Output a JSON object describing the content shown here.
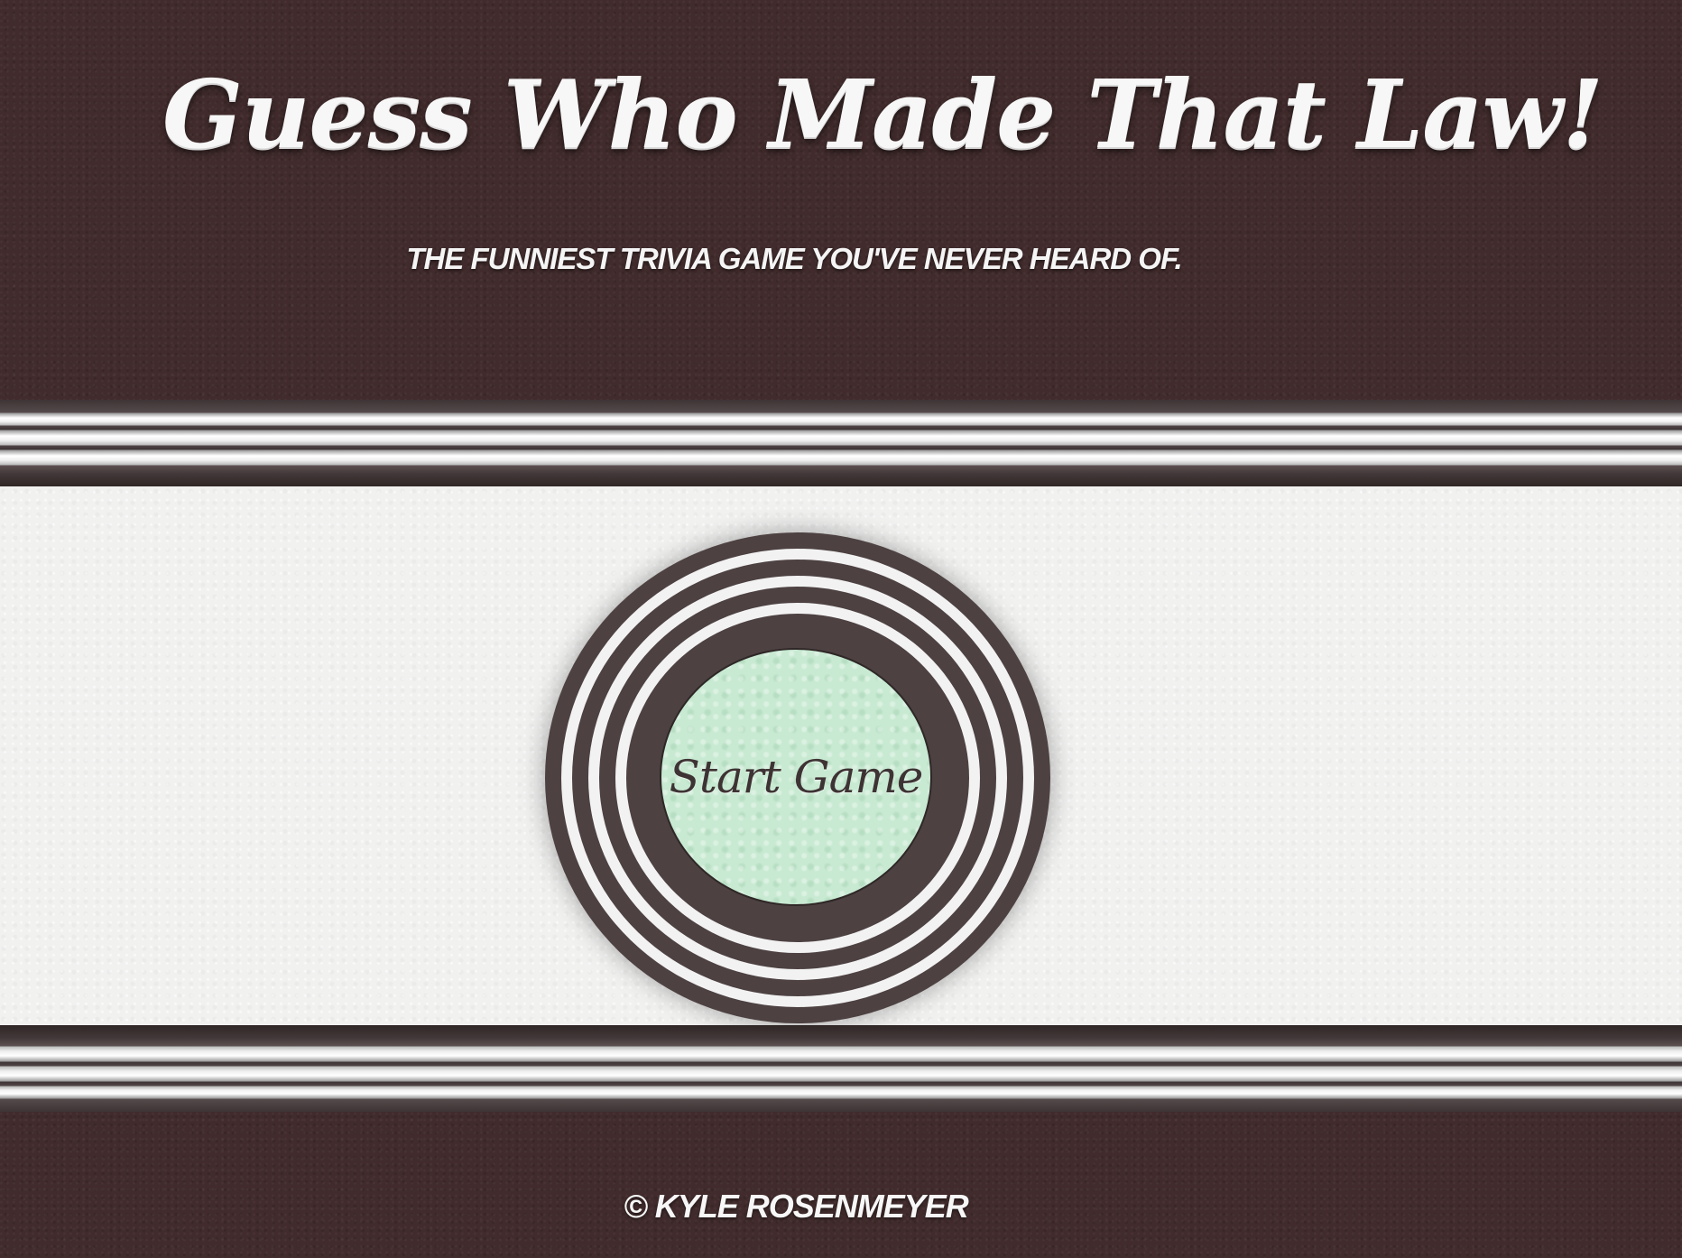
{
  "header": {
    "title": "Guess Who Made That Law!",
    "tagline": "The funniest trivia game you've never heard of."
  },
  "game": {
    "start_label": "Start Game"
  },
  "footer": {
    "copyright": "© Kyle Rosenmeyer"
  },
  "colors": {
    "leather_brown": "#412b2c",
    "ring_dark": "#4d4142",
    "ring_light": "#f2f2f2",
    "panel_white": "#f1f1f0",
    "button_mint": "#c8ead2",
    "text_light": "#f7f7f7"
  }
}
